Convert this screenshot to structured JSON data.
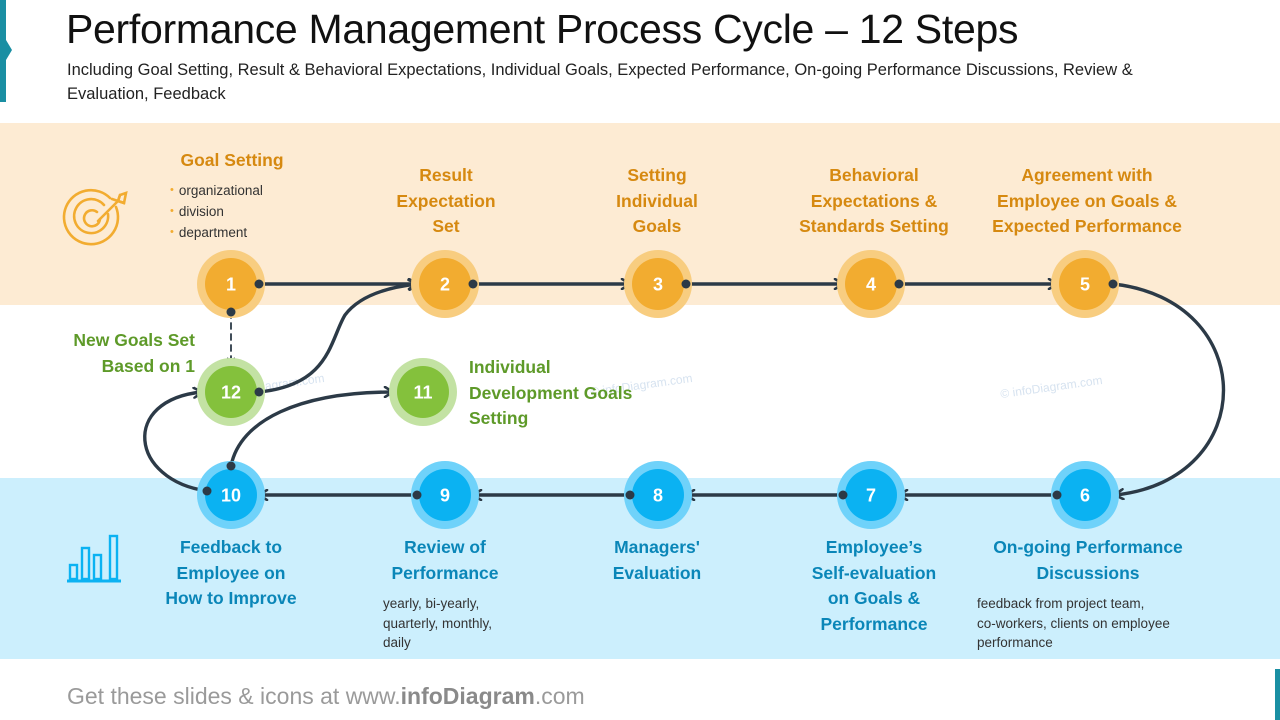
{
  "header": {
    "title": "Performance Management Process Cycle – 12 Steps",
    "subtitle": "Including Goal Setting, Result & Behavioral Expectations, Individual Goals, Expected Performance, On-going Performance Discussions, Review & Evaluation, Feedback"
  },
  "colors": {
    "orange": "#f2ac30",
    "orange_ring": "#f8cd80",
    "blue": "#0bb2f2",
    "blue_ring": "#6fd2fa",
    "green": "#84c13c",
    "green_ring": "#c3e2a3",
    "connector": "#2c3a47",
    "band_top": "#fdebd3",
    "band_bottom": "#cceffd",
    "accent": "#1a8fa3"
  },
  "icons": {
    "top": "target-icon",
    "bottom": "bar-chart-icon"
  },
  "steps": [
    {
      "number": "1",
      "title": "Goal Setting",
      "bullets": [
        "organizational",
        "division",
        "department"
      ],
      "color": "orange"
    },
    {
      "number": "2",
      "title": "Result\nExpectation\nSet",
      "color": "orange"
    },
    {
      "number": "3",
      "title": "Setting\nIndividual\nGoals",
      "color": "orange"
    },
    {
      "number": "4",
      "title": "Behavioral\nExpectations  &\nStandards  Setting",
      "color": "orange"
    },
    {
      "number": "5",
      "title": "Agreement with\nEmployee on Goals &\nExpected Performance",
      "color": "orange"
    },
    {
      "number": "6",
      "title": "On-going  Performance\nDiscussions",
      "note": "feedback from project team,\nco-workers, clients on employee\nperformance",
      "color": "blue"
    },
    {
      "number": "7",
      "title": "Employee’s\nSelf-evaluation\non Goals &\nPerformance",
      "color": "blue"
    },
    {
      "number": "8",
      "title": "Managers'\nEvaluation",
      "color": "blue"
    },
    {
      "number": "9",
      "title": "Review of\nPerformance",
      "note": "yearly, bi-yearly,\nquarterly,  monthly,\ndaily",
      "color": "blue"
    },
    {
      "number": "10",
      "title": "Feedback to\nEmployee on\nHow to Improve",
      "color": "blue"
    },
    {
      "number": "11",
      "title": "Individual\nDevelopment Goals\nSetting",
      "color": "green"
    },
    {
      "number": "12",
      "title": "New Goals Set\nBased on 1",
      "color": "green"
    }
  ],
  "watermarks": [
    "© infoDiagram.com",
    "© infoDiagram.com",
    "© infoDiagram.com"
  ],
  "footer": {
    "prefix": "Get these slides & icons at www.",
    "brand": "infoDiagram",
    "suffix": ".com"
  }
}
